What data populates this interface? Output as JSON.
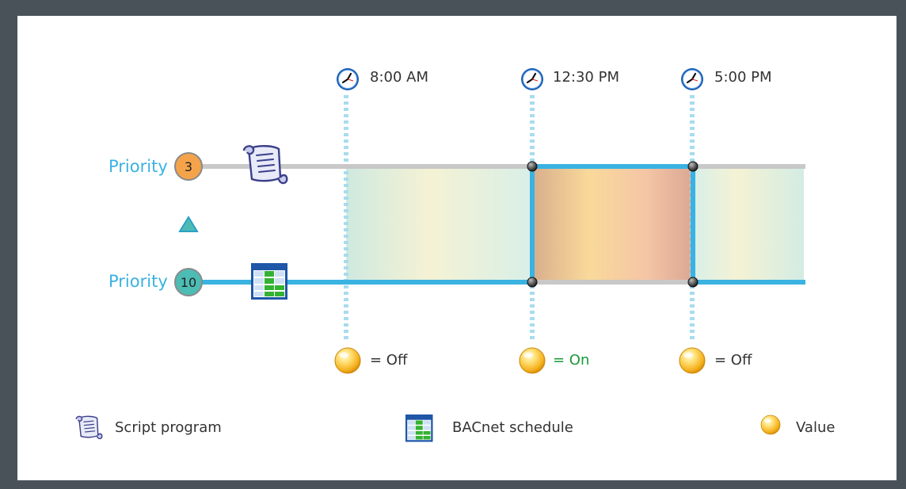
{
  "priorities": {
    "high": {
      "label": "Priority",
      "number": "3",
      "color": "#f5a34a"
    },
    "low": {
      "label": "Priority",
      "number": "10",
      "color": "#4dbcb5"
    }
  },
  "times": [
    "8:00 AM",
    "12:30 PM",
    "5:00 PM"
  ],
  "values": [
    {
      "text": "= Off",
      "color": "#333333"
    },
    {
      "text": "= On",
      "color": "#1a9a3a"
    },
    {
      "text": "= Off",
      "color": "#333333"
    }
  ],
  "legend": {
    "script": "Script program",
    "schedule": "BACnet schedule",
    "value": "Value"
  },
  "icons": {
    "clock": "clock-icon",
    "script": "script-scroll-icon",
    "schedule": "bacnet-schedule-icon",
    "value": "value-bulb-icon",
    "priority_arrow": "up-triangle-icon"
  },
  "colors": {
    "frame": "#4a5259",
    "active_line": "#3ab2e2",
    "inactive_line": "#c8c8c8",
    "priority_text": "#3ab2e2"
  }
}
